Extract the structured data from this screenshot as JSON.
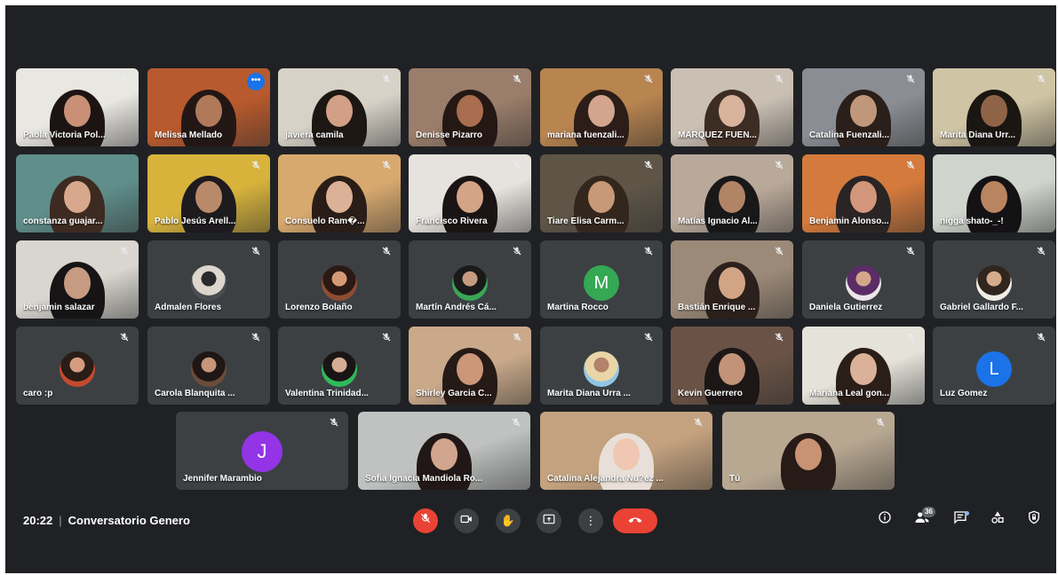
{
  "colors": {
    "accent": "#1a73e8",
    "danger": "#ea4335",
    "tile_bg": "#3c4043",
    "bg": "#202124"
  },
  "participants": [
    {
      "name": "Paola Victoria Pol...",
      "muted": true,
      "view": "video",
      "palette": [
        "#e9e7e2",
        "#1c1412",
        "#c99077"
      ]
    },
    {
      "name": "Melissa Mellado",
      "muted": false,
      "speaking": true,
      "more": true,
      "view": "video",
      "palette": [
        "#b85a2d",
        "#231715",
        "#b07a5a"
      ]
    },
    {
      "name": "javiera camila",
      "muted": true,
      "view": "video",
      "palette": [
        "#d7d2c8",
        "#1d1713",
        "#d2a087"
      ]
    },
    {
      "name": "Denisse Pizarro",
      "muted": true,
      "view": "video",
      "palette": [
        "#9a7d6a",
        "#241815",
        "#a96d4f"
      ]
    },
    {
      "name": "mariana fuenzali...",
      "muted": true,
      "view": "video",
      "palette": [
        "#b8844f",
        "#2c1d18",
        "#d3a58e"
      ]
    },
    {
      "name": "MARQUEZ FUEN...",
      "muted": true,
      "view": "video",
      "palette": [
        "#c9bfb3",
        "#3d2c22",
        "#d8b49d"
      ]
    },
    {
      "name": "Catalina Fuenzali...",
      "muted": true,
      "view": "video",
      "palette": [
        "#8a8d94",
        "#2a1f1a",
        "#c1977b"
      ]
    },
    {
      "name": "Marita Diana Urr...",
      "muted": true,
      "view": "video",
      "palette": [
        "#cfc4a4",
        "#1a1612",
        "#8f6446"
      ]
    },
    {
      "name": "constanza guajar...",
      "muted": false,
      "view": "video",
      "palette": [
        "#5f8e8b",
        "#3d2a20",
        "#d8a88c"
      ]
    },
    {
      "name": "Pablo Jesús Arell...",
      "muted": true,
      "view": "video",
      "palette": [
        "#d7b33c",
        "#1d1b1e",
        "#b98a6a"
      ]
    },
    {
      "name": "Consuelo Ram�...",
      "muted": true,
      "view": "video",
      "palette": [
        "#d8a96f",
        "#2a1d17",
        "#dbb197"
      ]
    },
    {
      "name": "Francisco Rivera",
      "muted": true,
      "view": "video",
      "palette": [
        "#e6e2dd",
        "#1a1514",
        "#d4a487"
      ]
    },
    {
      "name": "Tiare Elisa Carm...",
      "muted": true,
      "view": "video",
      "palette": [
        "#5e5547",
        "#33271d",
        "#c79977"
      ]
    },
    {
      "name": "Matías Ignacio Al...",
      "muted": true,
      "view": "video",
      "palette": [
        "#b9a99a",
        "#191818",
        "#b18466"
      ]
    },
    {
      "name": "Benjamin Alonso...",
      "muted": true,
      "view": "video",
      "palette": [
        "#d47a3c",
        "#2a2424",
        "#d4967a"
      ]
    },
    {
      "name": "nigga shato-_-!",
      "muted": false,
      "view": "video",
      "palette": [
        "#cfd4cc",
        "#141214",
        "#b98561"
      ]
    },
    {
      "name": "benjamin salazar",
      "muted": true,
      "view": "video",
      "palette": [
        "#d9d6d0",
        "#161414",
        "#c79a82"
      ]
    },
    {
      "name": "Admalen Flores",
      "muted": true,
      "view": "avatar",
      "palette": [
        "#4a4d52",
        "#ddd6cd",
        "#2a2a2c"
      ]
    },
    {
      "name": "Lorenzo Bolaño",
      "muted": true,
      "view": "avatar",
      "palette": [
        "#8e4d33",
        "#2a1914",
        "#d49a76"
      ]
    },
    {
      "name": "Martín Andrés Cá...",
      "muted": true,
      "view": "avatar",
      "palette": [
        "#3aa657",
        "#1a1a1a",
        "#c79b80"
      ]
    },
    {
      "name": "Martina Rocco",
      "muted": true,
      "view": "letter",
      "letter": "M",
      "letter_color": "#34a853"
    },
    {
      "name": "Bastián Enrique ...",
      "muted": true,
      "view": "video",
      "palette": [
        "#9c8a78",
        "#2b201b",
        "#d1a486"
      ]
    },
    {
      "name": "Daniela Gutierrez",
      "muted": true,
      "view": "avatar",
      "palette": [
        "#ece6e8",
        "#5c2c66",
        "#d5a789"
      ]
    },
    {
      "name": "Gabriel Gallardo F...",
      "muted": true,
      "view": "avatar",
      "palette": [
        "#f0ece6",
        "#31261e",
        "#d6ac8c"
      ]
    },
    {
      "name": "caro :p",
      "muted": true,
      "view": "avatar",
      "palette": [
        "#c54a2e",
        "#2a1c16",
        "#d59d7d"
      ]
    },
    {
      "name": "Carola Blanquita ...",
      "muted": true,
      "view": "avatar",
      "palette": [
        "#6b4b3a",
        "#1f1715",
        "#c6957a"
      ]
    },
    {
      "name": "Valentina Trinidad...",
      "muted": true,
      "view": "avatar",
      "palette": [
        "#2dbb5c",
        "#1a1515",
        "#d6ad94"
      ]
    },
    {
      "name": "Shirley Garcia C...",
      "muted": true,
      "view": "video",
      "palette": [
        "#c9a98a",
        "#261a16",
        "#cc9679"
      ]
    },
    {
      "name": "Marita Diana Urra ...",
      "muted": true,
      "view": "avatar",
      "palette": [
        "#8fc6e6",
        "#e9d5a8",
        "#b3826a"
      ]
    },
    {
      "name": "Kevin Guerrero",
      "muted": true,
      "view": "video",
      "palette": [
        "#6a5346",
        "#1c1716",
        "#c29378"
      ]
    },
    {
      "name": "Mariana Leal gon...",
      "muted": true,
      "view": "video",
      "palette": [
        "#e5e2da",
        "#2b1e18",
        "#dbb299"
      ]
    },
    {
      "name": "Luz Gomez",
      "muted": true,
      "view": "letter",
      "letter": "L",
      "letter_color": "#1a73e8"
    },
    {
      "name": "Jennifer Marambio",
      "muted": true,
      "view": "letter",
      "letter": "J",
      "letter_color": "#9334e6"
    },
    {
      "name": "Sofia Ignacia Mandiola Ro...",
      "muted": true,
      "view": "video",
      "palette": [
        "#bfc2c0",
        "#211716",
        "#d1a58e"
      ]
    },
    {
      "name": "Catalina Alejandra Nu?ez ...",
      "muted": true,
      "view": "video",
      "palette": [
        "#c4a27f",
        "#e8e0d8",
        "#f0c7b3"
      ]
    },
    {
      "name": "Tú",
      "muted": true,
      "view": "video",
      "palette": [
        "#b8a892",
        "#271b17",
        "#c99273"
      ]
    }
  ],
  "bottom_bar": {
    "time": "20:22",
    "separator": "|",
    "meeting_title": "Conversatorio Genero",
    "people_count": "36",
    "controls": [
      "microphone-off",
      "camera",
      "raise-hand",
      "present-screen",
      "more-options",
      "end-call"
    ],
    "right_icons": [
      "meeting-details",
      "people",
      "chat",
      "activities",
      "host-controls"
    ]
  }
}
